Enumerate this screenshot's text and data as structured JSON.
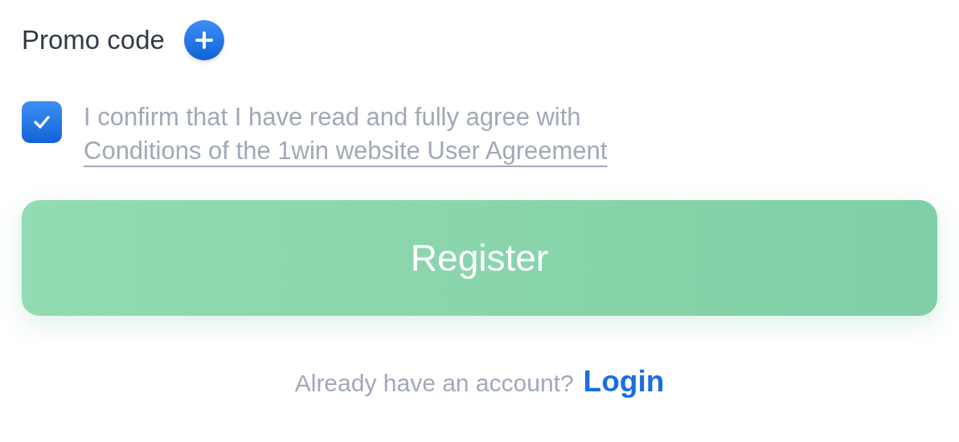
{
  "promo_code": {
    "label": "Promo code",
    "expanded": false
  },
  "agreement": {
    "checked": true,
    "text": "I confirm that I have read and fully agree with",
    "link": "Conditions of the 1win website User Agreement"
  },
  "register_button": {
    "label": "Register",
    "disabled": true
  },
  "footer": {
    "text": "Already have an account?",
    "link": "Login"
  }
}
